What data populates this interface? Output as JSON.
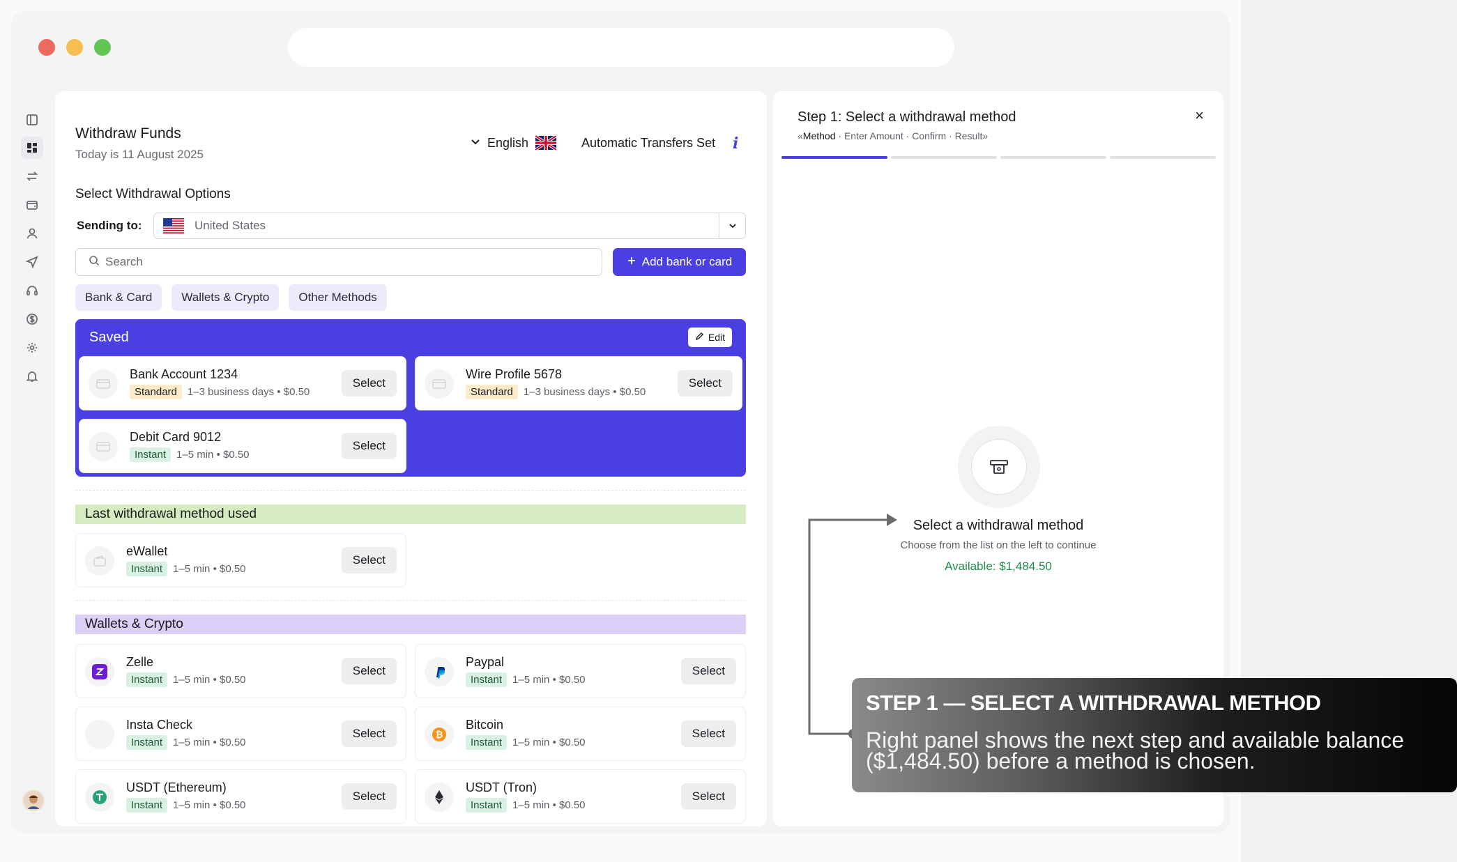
{
  "header": {
    "title": "Withdraw Funds",
    "date": "Today is 11 August 2025",
    "language": "English",
    "auto_transfers": "Automatic Transfers Set",
    "info_glyph": "i"
  },
  "options": {
    "section_title": "Select Withdrawal Options",
    "sending_label": "Sending to:",
    "country": "United States",
    "search_placeholder": "Search",
    "add_button": "Add bank or card",
    "tabs": [
      "Bank & Card",
      "Wallets & Crypto",
      "Other Methods"
    ]
  },
  "saved": {
    "title": "Saved",
    "edit_label": "Edit",
    "items": [
      {
        "name": "Bank Account 1234",
        "badge": "Standard",
        "meta": "1–3 business days • $0.50",
        "select": "Select"
      },
      {
        "name": "Wire Profile 5678",
        "badge": "Standard",
        "meta": "1–3 business days • $0.50",
        "select": "Select"
      },
      {
        "name": "Debit Card 9012",
        "badge": "Instant",
        "meta": "1–5 min • $0.50",
        "select": "Select"
      }
    ]
  },
  "last_used": {
    "title": "Last withdrawal method used",
    "items": [
      {
        "name": "eWallet",
        "badge": "Instant",
        "meta": "1–5 min • $0.50",
        "select": "Select"
      }
    ]
  },
  "wallets": {
    "title": "Wallets & Crypto",
    "items": [
      {
        "name": "Zelle",
        "badge": "Instant",
        "meta": "1–5 min • $0.50",
        "select": "Select",
        "icon": "zelle-icon"
      },
      {
        "name": "Paypal",
        "badge": "Instant",
        "meta": "1–5 min • $0.50",
        "select": "Select",
        "icon": "paypal-icon"
      },
      {
        "name": "Insta Check",
        "badge": "Instant",
        "meta": "1–5 min • $0.50",
        "select": "Select",
        "icon": "insta-check-icon"
      },
      {
        "name": "Bitcoin",
        "badge": "Instant",
        "meta": "1–5 min • $0.50",
        "select": "Select",
        "icon": "bitcoin-icon"
      },
      {
        "name": "USDT (Ethereum)",
        "badge": "Instant",
        "meta": "1–5 min • $0.50",
        "select": "Select",
        "icon": "usdt-icon"
      },
      {
        "name": "USDT (Tron)",
        "badge": "Instant",
        "meta": "1–5 min • $0.50",
        "select": "Select",
        "icon": "ethereum-icon"
      }
    ]
  },
  "right_panel": {
    "title": "Step 1: Select a withdrawal method",
    "steps_current": "Method",
    "steps_rest": " · Enter Amount · Confirm · Result»",
    "steps_open": "«",
    "close_glyph": "×",
    "progress_segments": 4,
    "progress_active": 1,
    "empty_title": "Select a withdrawal method",
    "empty_subtitle": "Choose from the list on the left to continue",
    "available": "Available: $1,484.50"
  },
  "callout": {
    "title": "STEP 1 — SELECT A WITHDRAWAL METHOD",
    "body": "Right panel shows the next step and available balance ($1,484.50) before a method is chosen."
  },
  "colors": {
    "accent": "#4a3fe0",
    "available": "#1f8b4c",
    "last_used_bar": "#d4ecc0",
    "wallets_bar": "#dcd0f7"
  }
}
